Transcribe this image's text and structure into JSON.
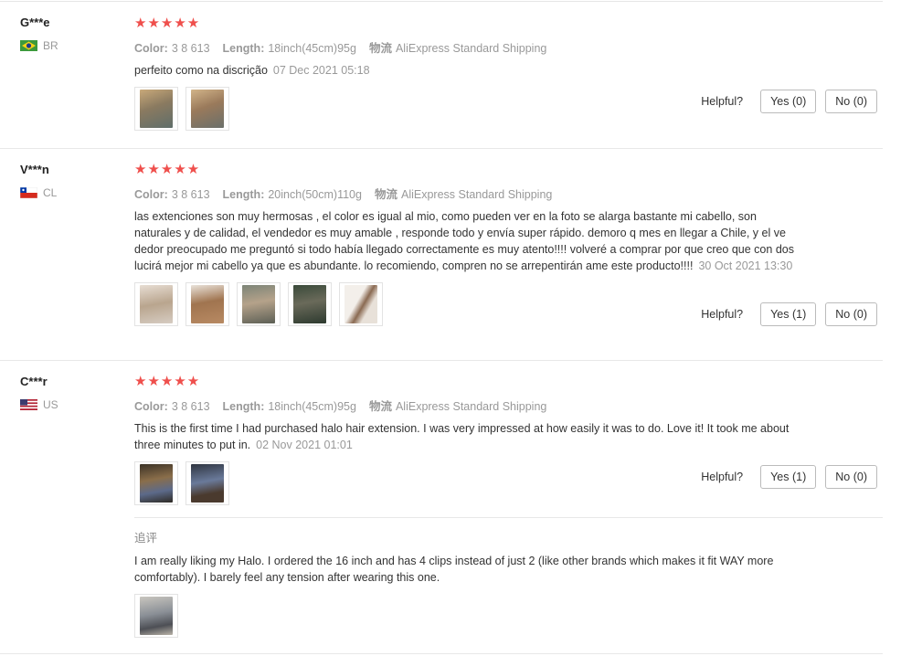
{
  "labels": {
    "color": "Color:",
    "length": "Length:",
    "shipping": "物流",
    "helpful": "Helpful?",
    "followup_title": "追评"
  },
  "colors": {
    "star": "#ef4f4c"
  },
  "reviews": [
    {
      "user": "G***e",
      "country": "BR",
      "stars": "★★★★★",
      "color": "3 8 613",
      "length": "18inch(45cm)95g",
      "shipping": "AliExpress Standard Shipping",
      "text": "perfeito como na discrição",
      "date": "07 Dec 2021 05:18",
      "yes": "Yes (0)",
      "no": "No (0)"
    },
    {
      "user": "V***n",
      "country": "CL",
      "stars": "★★★★★",
      "color": "3 8 613",
      "length": "20inch(50cm)110g",
      "shipping": "AliExpress Standard Shipping",
      "text": "las extenciones son muy hermosas , el color es igual al mio, como pueden ver en la foto se alarga bastante mi cabello, son naturales y de calidad, el vendedor es muy amable , responde todo y envía super rápido. demoro q mes en llegar a Chile, y el ve dedor preocupado me preguntó si todo había llegado correctamente es muy atento!!!! volveré a comprar por que creo que con dos lucirá mejor mi cabello ya que es abundante. lo recomiendo, compren no se arrepentirán ame este producto!!!!",
      "date": "30 Oct 2021 13:30",
      "yes": "Yes (1)",
      "no": "No (0)"
    },
    {
      "user": "C***r",
      "country": "US",
      "stars": "★★★★★",
      "color": "3 8 613",
      "length": "18inch(45cm)95g",
      "shipping": "AliExpress Standard Shipping",
      "text": "This is the first time I had purchased halo hair extension. I was very impressed at how easily it was to do. Love it! It took me about three minutes to put in.",
      "date": "02 Nov 2021 01:01",
      "yes": "Yes (1)",
      "no": "No (0)",
      "followup": "I am really liking my Halo. I ordered the 16 inch and has 4 clips instead of just 2 (like other brands which makes it fit WAY more comfortably). I barely feel any tension after wearing this one."
    }
  ]
}
